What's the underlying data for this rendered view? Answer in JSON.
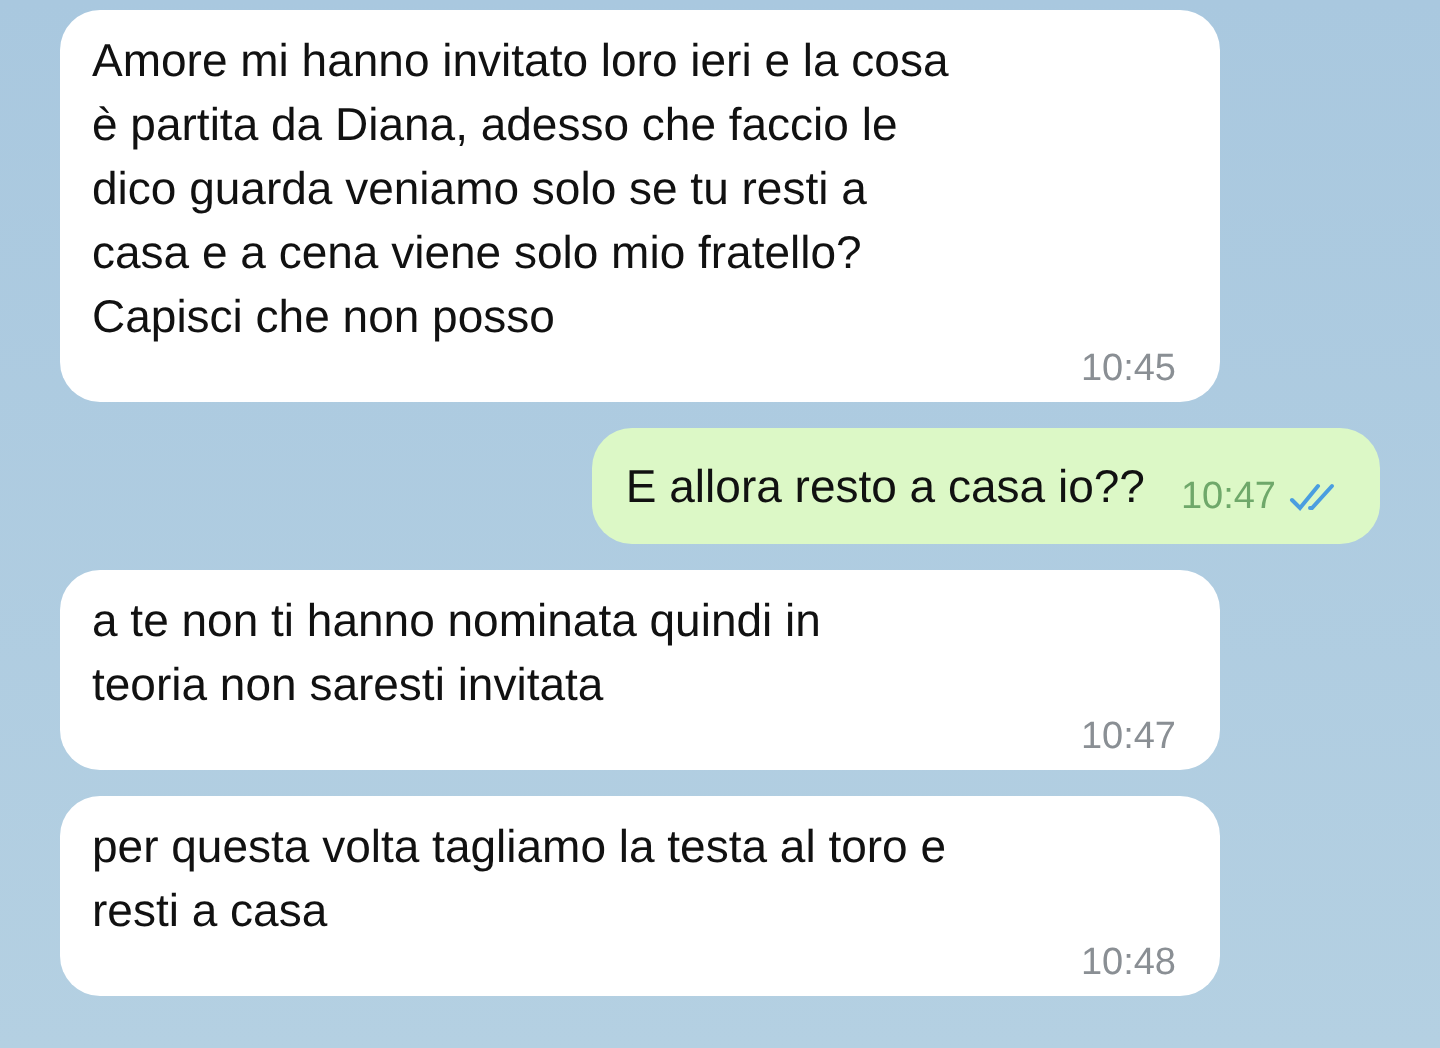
{
  "messages": [
    {
      "kind": "incoming",
      "text": "Amore mi hanno invitato loro ieri e la cosa\nè partita da Diana, adesso che faccio le\ndico guarda veniamo solo se tu resti a\ncasa e a cena viene solo mio fratello?\nCapisci che non posso",
      "time": "10:45"
    },
    {
      "kind": "outgoing",
      "text": "E allora resto a casa io??",
      "time": "10:47",
      "read": true
    },
    {
      "kind": "incoming",
      "text": "a te non ti hanno nominata quindi in\nteoria non saresti invitata",
      "time": "10:47"
    },
    {
      "kind": "incoming",
      "text": "per questa volta tagliamo la testa al toro e\nresti a casa",
      "time": "10:48"
    }
  ]
}
